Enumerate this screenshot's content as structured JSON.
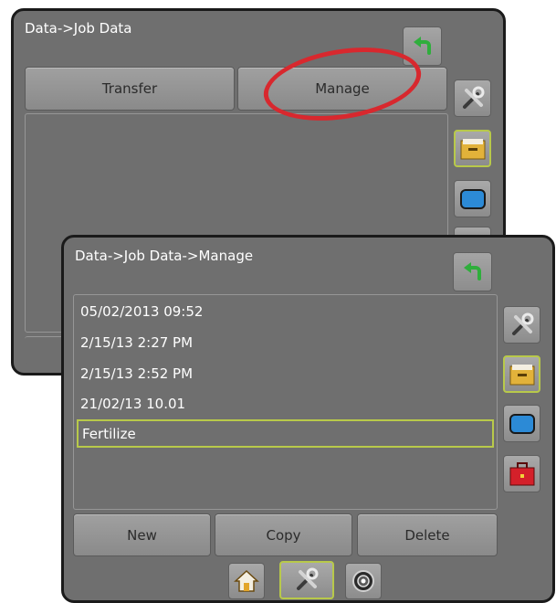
{
  "back_screen": {
    "breadcrumb": "Data->Job Data",
    "tabs": [
      {
        "label": "Transfer"
      },
      {
        "label": "Manage"
      }
    ],
    "side_icons": [
      "tools-icon",
      "file-box-icon",
      "display-icon"
    ]
  },
  "front_screen": {
    "breadcrumb": "Data->Job Data->Manage",
    "jobs": [
      {
        "label": "05/02/2013 09:52",
        "selected": false
      },
      {
        "label": "2/15/13 2:27 PM",
        "selected": false
      },
      {
        "label": "2/15/13 2:52 PM",
        "selected": false
      },
      {
        "label": "21/02/13 10.01",
        "selected": false
      },
      {
        "label": "Fertilize",
        "selected": true
      }
    ],
    "actions": [
      {
        "label": "New"
      },
      {
        "label": "Copy"
      },
      {
        "label": "Delete"
      }
    ],
    "side_icons": [
      "tools-icon",
      "file-box-icon",
      "display-icon",
      "toolbox-icon"
    ],
    "bottom_nav": [
      "home-icon",
      "tools-icon",
      "camera-lens-icon"
    ]
  },
  "colors": {
    "screen_bg": "#6f6f6f",
    "selected_border": "#b8c94a",
    "annotation": "#d8282e",
    "back_arrow": "#2fae3c"
  }
}
